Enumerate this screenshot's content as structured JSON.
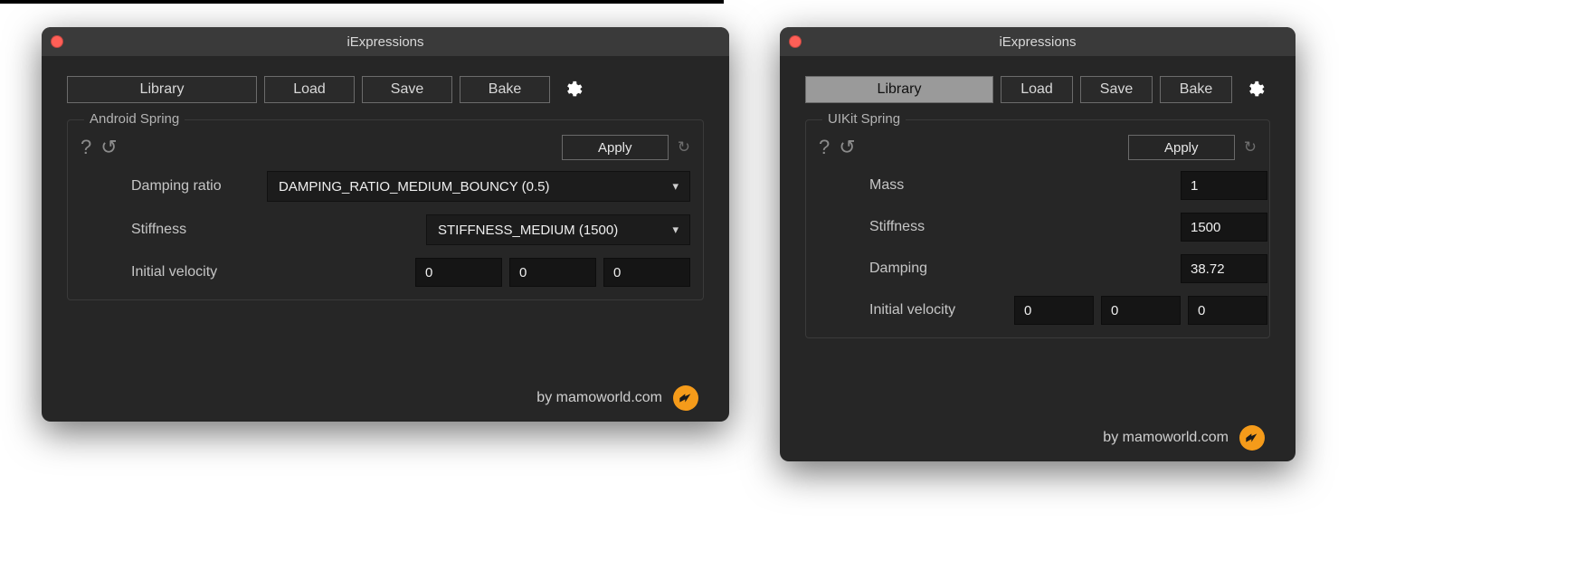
{
  "left_panel": {
    "title": "iExpressions",
    "toolbar": {
      "library": "Library",
      "load": "Load",
      "save": "Save",
      "bake": "Bake"
    },
    "group_title": "Android Spring",
    "apply": "Apply",
    "params": {
      "damping_ratio": {
        "label": "Damping ratio",
        "value": "DAMPING_RATIO_MEDIUM_BOUNCY (0.5)"
      },
      "stiffness": {
        "label": "Stiffness",
        "value": "STIFFNESS_MEDIUM (1500)"
      },
      "initial_velocity": {
        "label": "Initial velocity",
        "x": "0",
        "y": "0",
        "z": "0"
      }
    },
    "footer": "by mamoworld.com"
  },
  "right_panel": {
    "title": "iExpressions",
    "toolbar": {
      "library": "Library",
      "load": "Load",
      "save": "Save",
      "bake": "Bake"
    },
    "group_title": "UIKit Spring",
    "apply": "Apply",
    "params": {
      "mass": {
        "label": "Mass",
        "value": "1"
      },
      "stiffness": {
        "label": "Stiffness",
        "value": "1500"
      },
      "damping": {
        "label": "Damping",
        "value": "38.72"
      },
      "initial_velocity": {
        "label": "Initial velocity",
        "x": "0",
        "y": "0",
        "z": "0"
      }
    },
    "footer": "by mamoworld.com"
  }
}
